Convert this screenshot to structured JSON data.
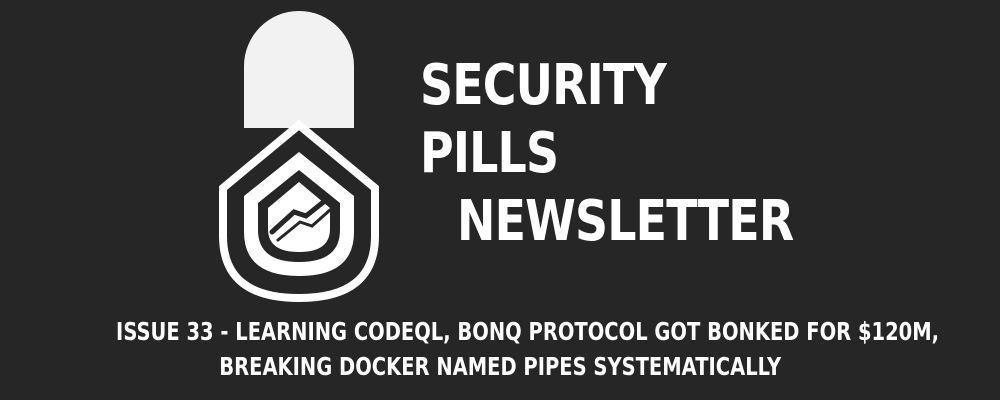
{
  "banner": {
    "background_color": "#262626",
    "text_color": "#ffffff",
    "logo_icon": "security-pill-shield-icon",
    "title_lines": [
      "SECURITY",
      "PILLS",
      "NEWSLETTER"
    ],
    "subtitle_lines": [
      "ISSUE 33 - LEARNING CODEQL, BONQ PROTOCOL GOT BONKED FOR $120M,",
      "BREAKING DOCKER NAMED PIPES SYSTEMATICALLY"
    ]
  }
}
